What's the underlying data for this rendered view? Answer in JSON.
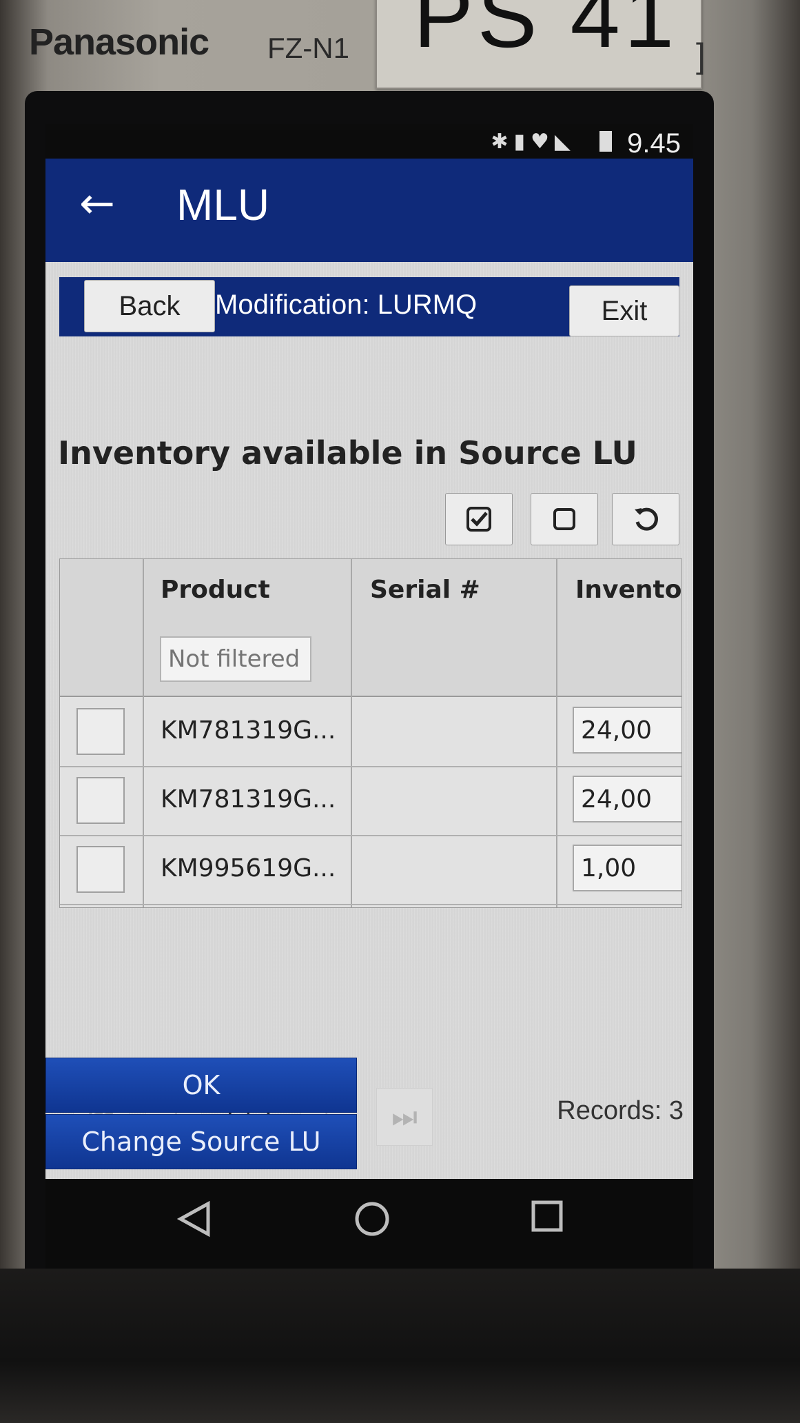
{
  "device": {
    "brand": "Panasonic",
    "model": "FZ-N1",
    "sticker_label": "PS 41"
  },
  "status_bar": {
    "icons": [
      "bluetooth-icon",
      "sim-icon",
      "wifi-icon",
      "no-signal-icon",
      "battery-icon"
    ],
    "time": "9.45"
  },
  "app_bar": {
    "back_icon": "arrow-left-icon",
    "title": "MLU"
  },
  "header": {
    "back_label": "Back",
    "title": "Modification: LURMQ",
    "exit_label": "Exit"
  },
  "section": {
    "title": "Inventory available in Source LU"
  },
  "toolbar": {
    "buttons": [
      {
        "name": "select-all",
        "icon": "checked-box-icon"
      },
      {
        "name": "deselect-all",
        "icon": "empty-box-icon"
      },
      {
        "name": "reset",
        "icon": "undo-icon"
      }
    ]
  },
  "table": {
    "columns": [
      "",
      "Product",
      "Serial #",
      "Inventor"
    ],
    "filter_placeholder": "Not filtered",
    "rows": [
      {
        "product": "KM781319G...",
        "serial": "",
        "inventory": "24,00"
      },
      {
        "product": "KM781319G...",
        "serial": "",
        "inventory": "24,00"
      },
      {
        "product": "KM995619G...",
        "serial": "",
        "inventory": "1,00"
      }
    ]
  },
  "pager": {
    "page": "1 / 1",
    "records": "Records: 3"
  },
  "actions": {
    "ok_label": "OK",
    "change_source_label": "Change Source LU"
  },
  "nav": {
    "icons": [
      "back-triangle-icon",
      "home-circle-icon",
      "recents-square-icon"
    ]
  },
  "colors": {
    "app_bar": "#0f2a7a",
    "action_button": "#1a44a8"
  }
}
